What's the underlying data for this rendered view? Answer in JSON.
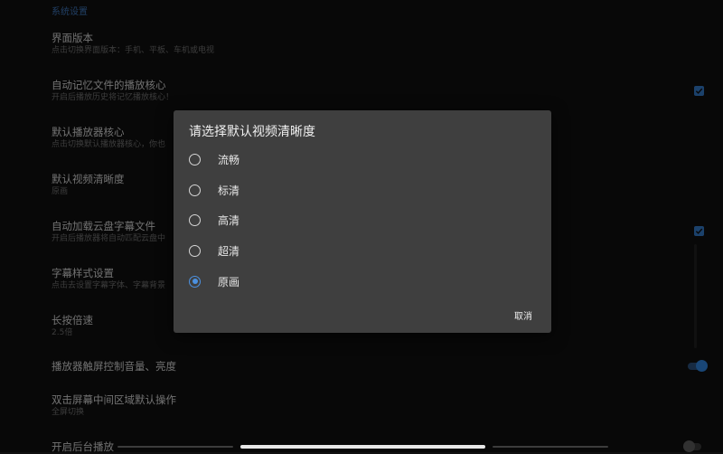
{
  "section_header": "系统设置",
  "settings": [
    {
      "title": "界面版本",
      "subtitle": "点击切换界面版本：手机、平板、车机或电视"
    },
    {
      "title": "自动记忆文件的播放核心",
      "subtitle": "开启后播放历史将记忆播放核心！"
    },
    {
      "title": "默认播放器核心",
      "subtitle": "点击切换默认播放器核心，你也"
    },
    {
      "title": "默认视频清晰度",
      "subtitle": "原画"
    },
    {
      "title": "自动加载云盘字幕文件",
      "subtitle": "开启后播放器将自动匹配云盘中"
    },
    {
      "title": "字幕样式设置",
      "subtitle": "点击去设置字幕字体、字幕背景"
    },
    {
      "title": "长按倍速",
      "subtitle": "2.5倍"
    },
    {
      "title": "播放器触屏控制音量、亮度",
      "subtitle": ""
    },
    {
      "title": "双击屏幕中间区域默认操作",
      "subtitle": "全屏切换"
    },
    {
      "title": "开启后台播放",
      "subtitle": ""
    }
  ],
  "controls": {
    "remember_core_checked": true,
    "auto_subtitle_checked": true,
    "touch_volume_toggle": "on",
    "background_play_toggle": "off"
  },
  "dialog": {
    "title": "请选择默认视频清晰度",
    "options": [
      {
        "label": "流畅",
        "selected": false
      },
      {
        "label": "标清",
        "selected": false
      },
      {
        "label": "高清",
        "selected": false
      },
      {
        "label": "超清",
        "selected": false
      },
      {
        "label": "原画",
        "selected": true
      }
    ],
    "cancel_label": "取消"
  },
  "colors": {
    "accent": "#4c91e0",
    "dialog_bg": "#3f3f3f",
    "page_bg": "#101010"
  }
}
